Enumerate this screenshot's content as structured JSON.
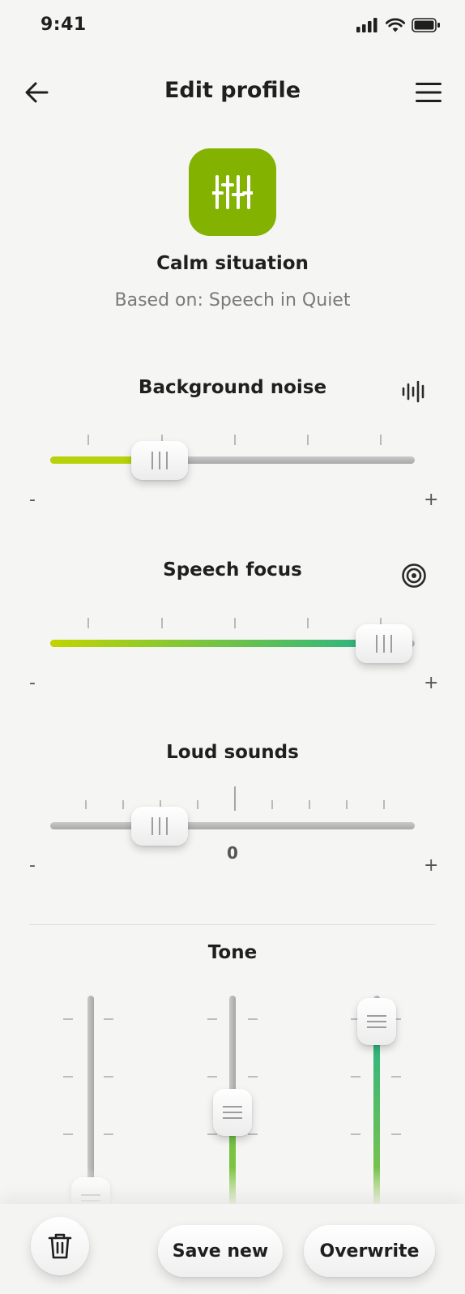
{
  "status": {
    "time": "9:41"
  },
  "header": {
    "title": "Edit profile",
    "back_icon": "arrow-left-icon",
    "menu_icon": "hamburger-menu-icon"
  },
  "profile": {
    "name": "Calm situation",
    "based_on": "Based on: Speech in Quiet",
    "icon": "sliders-icon",
    "tile_color": "#83b300"
  },
  "background_noise": {
    "label": "Background noise",
    "icon": "sound-wave-icon",
    "min": "-",
    "max": "+",
    "value_fraction": 0.3
  },
  "speech_focus": {
    "label": "Speech focus",
    "icon": "focus-target-icon",
    "min": "-",
    "max": "+",
    "value_fraction": 0.92
  },
  "loud_sounds": {
    "label": "Loud sounds",
    "min": "-",
    "max": "+",
    "center_value": "0",
    "value_fraction": 0.3
  },
  "tone": {
    "label": "Tone",
    "sliders_value_fraction": [
      0.0,
      0.45,
      0.95
    ]
  },
  "actions": {
    "delete_icon": "trash-icon",
    "save_new": "Save new",
    "overwrite": "Overwrite"
  },
  "colors": {
    "accent_green": "#83b300",
    "gradient_start": "#c1d400",
    "gradient_end": "#23b38a"
  }
}
